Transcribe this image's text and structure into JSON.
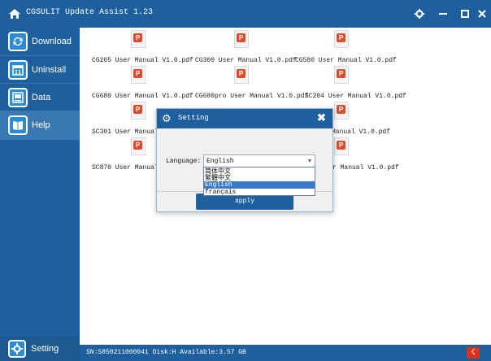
{
  "window": {
    "title": "CGSULIT Update Assist 1.23",
    "icons": [
      "home-icon",
      "gear-icon",
      "minimize-icon",
      "maximize-icon",
      "close-icon"
    ]
  },
  "sidebar": {
    "items": [
      {
        "label": "Download",
        "icon": "download-icon"
      },
      {
        "label": "Uninstall",
        "icon": "uninstall-icon"
      },
      {
        "label": "Data",
        "icon": "data-icon"
      },
      {
        "label": "Help",
        "icon": "help-icon"
      }
    ],
    "setting": {
      "label": "Setting",
      "icon": "setting-icon"
    }
  },
  "files": [
    {
      "name": "CG205 User Manual V1.0.pdf"
    },
    {
      "name": "CG300 User Manual V1.0.pdf"
    },
    {
      "name": "CG580 User Manual V1.0.pdf"
    },
    {
      "name": "CG680 User Manual V1.0.pdf"
    },
    {
      "name": "CG680pro User Manual V1.0.pdf"
    },
    {
      "name": "SC204 User Manual V1.0.pdf"
    },
    {
      "name": "SC301 User Manual"
    },
    {
      "name": "Manual V1.0.pdf"
    },
    {
      "name": "SC870 User Manual"
    },
    {
      "name": "r Manual V1.0.pdf"
    }
  ],
  "status": {
    "text": "SN:S850211000041  Disk:H  Available:3.57 GB",
    "icon": "plug-icon"
  },
  "dialog": {
    "title": "Setting",
    "language_label": "Language:",
    "language_value": "English",
    "options": [
      "简体中文",
      "繁體中文",
      "English",
      "français"
    ],
    "selected_option": "English",
    "apply_label": "apply"
  },
  "colors": {
    "brand": "#1e5f9e",
    "active_item": "#3a78b4",
    "pdf_red": "#e04b2e",
    "highlight": "#3a78c8"
  }
}
